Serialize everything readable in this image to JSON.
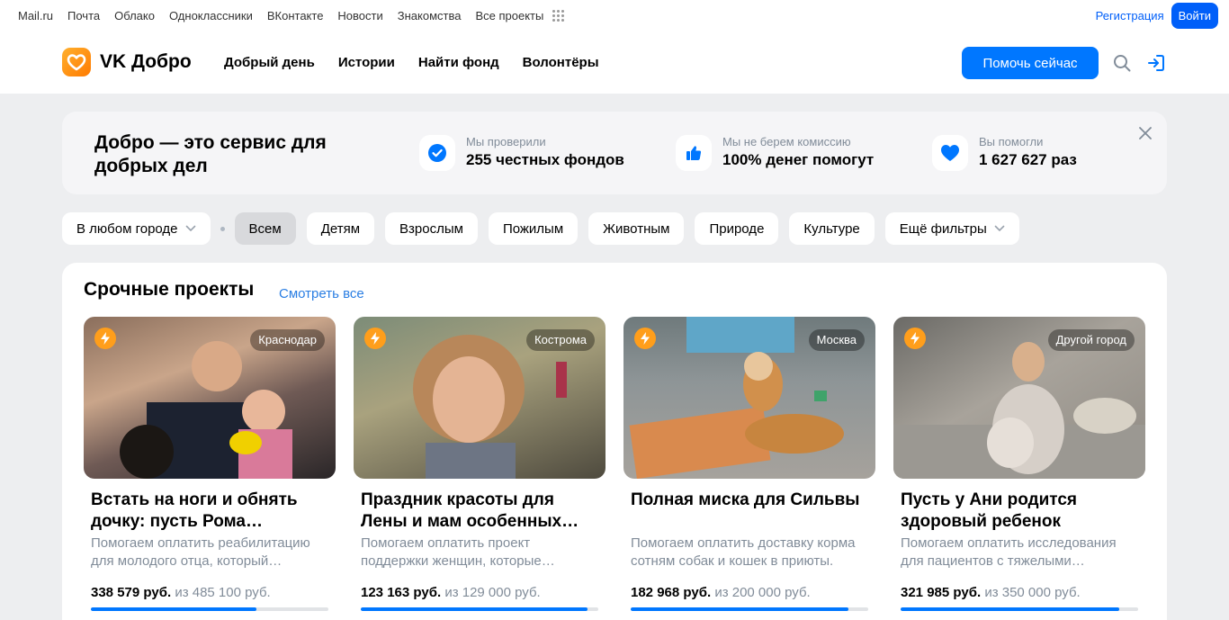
{
  "portal": {
    "links": [
      "Mail.ru",
      "Почта",
      "Облако",
      "Одноклассники",
      "ВКонтакте",
      "Новости",
      "Знакомства",
      "Все проекты"
    ],
    "register_label": "Регистрация",
    "login_label": "Войти"
  },
  "header": {
    "logo_text": "VK Добро",
    "nav": [
      "Добрый день",
      "Истории",
      "Найти фонд",
      "Волонтёры"
    ],
    "help_label": "Помочь сейчас"
  },
  "banner": {
    "title": "Добро — это сервис для добрых дел",
    "stats": [
      {
        "small": "Мы проверили",
        "big": "255 честных фондов",
        "icon": "check-icon"
      },
      {
        "small": "Мы не берем комиссию",
        "big": "100% денег помогут",
        "icon": "thumbs-up-icon"
      },
      {
        "small": "Вы помогли",
        "big": "1 627 627 раз",
        "icon": "heart-icon"
      }
    ]
  },
  "filters": {
    "city": "В любом городе",
    "chips": [
      "Всем",
      "Детям",
      "Взрослым",
      "Пожилым",
      "Животным",
      "Природе",
      "Культуре"
    ],
    "active_index": 0,
    "more": "Ещё фильтры"
  },
  "urgent": {
    "title": "Срочные проекты",
    "see_all": "Смотреть все",
    "cards": [
      {
        "city": "Краснодар",
        "title": "Встать на ноги и обнять дочку: пусть Рома…",
        "desc": "Помогаем оплатить реабилитацию для молодого отца, который…",
        "raised": "338 579 руб.",
        "goal": "из 485 100 руб.",
        "progress": 0.698
      },
      {
        "city": "Кострома",
        "title": "Праздник красоты для Лены и мам особенных…",
        "desc": "Помогаем оплатить проект поддержки женщин, которые…",
        "raised": "123 163 руб.",
        "goal": "из 129 000 руб.",
        "progress": 0.955
      },
      {
        "city": "Москва",
        "title": "Полная миска для Сильвы",
        "desc": "Помогаем оплатить доставку корма сотням собак и кошек в приюты.",
        "raised": "182 968 руб.",
        "goal": "из 200 000 руб.",
        "progress": 0.915
      },
      {
        "city": "Другой город",
        "title": "Пусть у Ани родится здоровый ребенок",
        "desc": "Помогаем оплатить исследования для пациентов с тяжелыми…",
        "raised": "321 985 руб.",
        "goal": "из 350 000 руб.",
        "progress": 0.92
      }
    ]
  },
  "colors": {
    "accent": "#0077ff",
    "portal_blue": "#005ff9",
    "bolt": "#ff9e1b",
    "page_bg": "#edeef0"
  }
}
